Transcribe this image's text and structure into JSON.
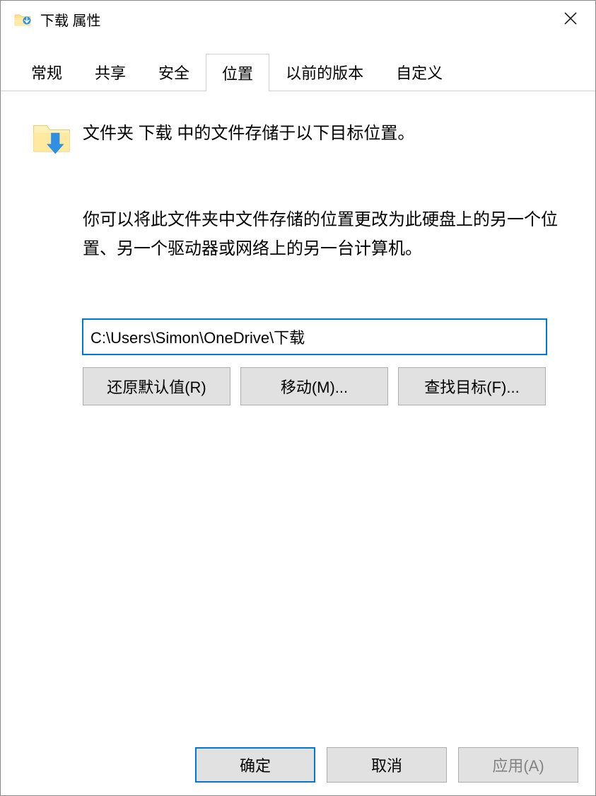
{
  "window": {
    "title": "下载 属性"
  },
  "tabs": {
    "general": "常规",
    "sharing": "共享",
    "security": "安全",
    "location": "位置",
    "previous": "以前的版本",
    "custom": "自定义"
  },
  "location_tab": {
    "headline": "文件夹 下载 中的文件存储于以下目标位置。",
    "description": "你可以将此文件夹中文件存储的位置更改为此硬盘上的另一个位置、另一个驱动器或网络上的另一台计算机。",
    "path_value": "C:\\Users\\Simon\\OneDrive\\下载",
    "buttons": {
      "restore": "还原默认值(R)",
      "move": "移动(M)...",
      "find": "查找目标(F)..."
    }
  },
  "footer": {
    "ok": "确定",
    "cancel": "取消",
    "apply": "应用(A)"
  }
}
